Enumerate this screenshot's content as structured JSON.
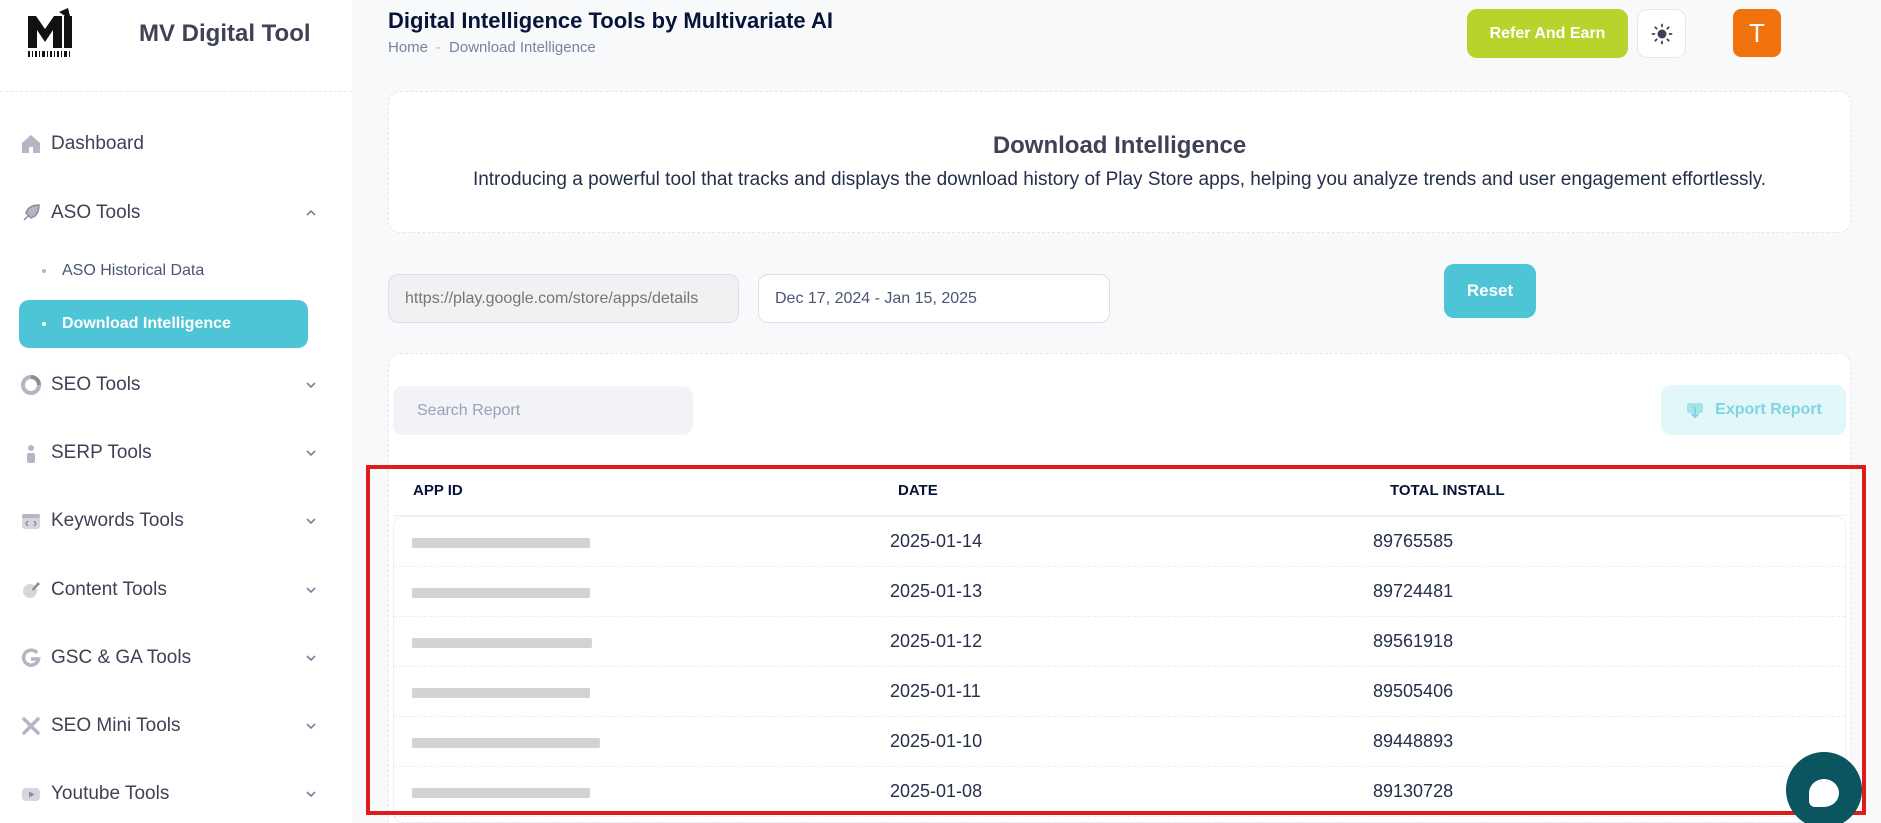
{
  "app": {
    "name": "MV Digital Tool"
  },
  "sidebar": {
    "items": [
      {
        "label": "Dashboard",
        "icon": "home-icon"
      },
      {
        "label": "ASO Tools",
        "icon": "rocket-icon",
        "expanded": true
      },
      {
        "label": "SEO Tools",
        "icon": "chart-donut-icon"
      },
      {
        "label": "SERP Tools",
        "icon": "user-icon"
      },
      {
        "label": "Keywords Tools",
        "icon": "code-window-icon"
      },
      {
        "label": "Content Tools",
        "icon": "pen-icon"
      },
      {
        "label": "GSC & GA Tools",
        "icon": "google-icon"
      },
      {
        "label": "SEO Mini Tools",
        "icon": "tools-icon"
      },
      {
        "label": "Youtube Tools",
        "icon": "youtube-icon"
      }
    ],
    "aso_subitems": [
      {
        "label": "ASO Historical Data",
        "active": false
      },
      {
        "label": "Download Intelligence",
        "active": true
      }
    ]
  },
  "header": {
    "title": "Digital Intelligence Tools by Multivariate AI",
    "breadcrumb": [
      "Home",
      "Download Intelligence"
    ],
    "refer_label": "Refer And Earn",
    "avatar_initial": "T"
  },
  "intro": {
    "title": "Download Intelligence",
    "description": "Introducing a powerful tool that tracks and displays the download history of Play Store apps, helping you analyze trends and user engagement effortlessly."
  },
  "filters": {
    "url_placeholder": "https://play.google.com/store/apps/details",
    "date_range": "Dec 17, 2024 - Jan 15, 2025",
    "reset_label": "Reset"
  },
  "report": {
    "search_placeholder": "Search Report",
    "export_label": "Export Report",
    "columns": [
      "APP ID",
      "DATE",
      "TOTAL INSTALL"
    ],
    "rows": [
      {
        "date": "2025-01-14",
        "total_install": "89765585"
      },
      {
        "date": "2025-01-13",
        "total_install": "89724481"
      },
      {
        "date": "2025-01-12",
        "total_install": "89561918"
      },
      {
        "date": "2025-01-11",
        "total_install": "89505406"
      },
      {
        "date": "2025-01-10",
        "total_install": "89448893"
      },
      {
        "date": "2025-01-08",
        "total_install": "89130728"
      }
    ]
  },
  "colors": {
    "accent": "#4ec5d7",
    "refer": "#b7d32c",
    "avatar": "#f0720c",
    "highlight": "#e01b1b"
  }
}
